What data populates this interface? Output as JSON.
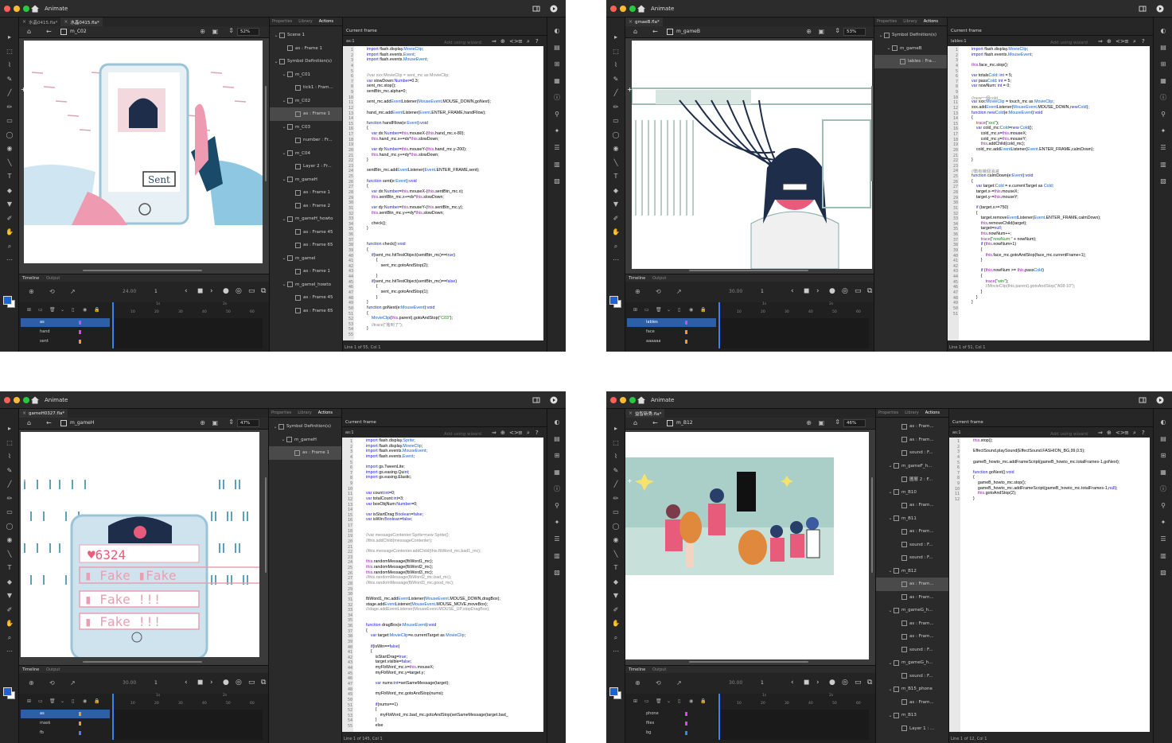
{
  "theme": {
    "accent": "#2d5fa6",
    "layer_pink": "#d946ef",
    "layer_orange": "#f59e0b"
  },
  "app_title": "Animate",
  "windows": [
    {
      "id": "w1",
      "tabs": [
        "水晶0415.fla*",
        "水晶0415.fla*"
      ],
      "symbol": "m_C02",
      "zoom": "52%",
      "fps": "24.00",
      "frame": "1",
      "props_tabs": [
        "Properties",
        "Library",
        "Actions"
      ],
      "tree": [
        {
          "label": "Scene 1",
          "level": 0,
          "chev": "v"
        },
        {
          "label": "as : Frame 1",
          "level": 1,
          "chev": ""
        },
        {
          "label": "Symbol Definition(s)",
          "level": 0,
          "chev": "v"
        },
        {
          "label": "m_C01",
          "level": 1,
          "chev": "v"
        },
        {
          "label": "tick1 : Fram...",
          "level": 2,
          "chev": ""
        },
        {
          "label": "m_C02",
          "level": 1,
          "chev": "v"
        },
        {
          "label": "as : Frame 1",
          "level": 2,
          "chev": "",
          "sel": true
        },
        {
          "label": "m_C03",
          "level": 1,
          "chev": "v"
        },
        {
          "label": "number : Fr...",
          "level": 2,
          "chev": ""
        },
        {
          "label": "m_C04",
          "level": 1,
          "chev": "v"
        },
        {
          "label": "Layer 2 : Fr...",
          "level": 2,
          "chev": ""
        },
        {
          "label": "m_gameH",
          "level": 1,
          "chev": "v"
        },
        {
          "label": "as : Frame 1",
          "level": 2,
          "chev": ""
        },
        {
          "label": "as : Frame 2",
          "level": 2,
          "chev": ""
        },
        {
          "label": "m_gameH_howto",
          "level": 1,
          "chev": "v"
        },
        {
          "label": "as : Frame 45",
          "level": 2,
          "chev": ""
        },
        {
          "label": "as : Frame 65",
          "level": 2,
          "chev": ""
        },
        {
          "label": "m_gameI",
          "level": 1,
          "chev": "v"
        },
        {
          "label": "as : Frame 1",
          "level": 2,
          "chev": ""
        },
        {
          "label": "m_gameI_howto",
          "level": 1,
          "chev": "v"
        },
        {
          "label": "as : Frame 45",
          "level": 2,
          "chev": ""
        },
        {
          "label": "as : Frame 65",
          "level": 2,
          "chev": ""
        }
      ],
      "actions_header": "Current frame",
      "actions_frame": "as:1",
      "wizard": "Add using wizard",
      "code": [
        "import flash.display.MovieClip;",
        "import flash.events.Event;",
        "import flash.events.MouseEvent;",
        "",
        "",
        "//var xxx:MovieClip = sent_mc as MovieClip;",
        "var slowDown:Number=0.3;",
        "sent_mc.stop();",
        "sentBtn_mc.alpha=0;",
        "",
        "sent_mc.addEventListener(MouseEvent.MOUSE_DOWN,goNext);",
        "",
        "hand_mc.addEventListener(Event.ENTER_FRAME,handFllow);",
        "",
        "function handFllow(e:Event):void",
        "{",
        "    var dx:Number=this.mouseX-(this.hand_mc.x-80);",
        "    this.hand_mc.x+=dx*this.slowDown;",
        "",
        "    var dy:Number=this.mouseY-(this.hand_mc.y-200);",
        "    this.hand_mc.y+=dy*this.slowDown;",
        "}",
        "",
        "sentBtn_mc.addEventListener(Event.ENTER_FRAME,sent);",
        "",
        "function sent(e:Event):void",
        "{",
        "    var dx:Number=this.mouseX-(this.sentBtn_mc.x);",
        "    this.sentBtn_mc.x+=dx*this.slowDown;",
        "",
        "    var dy:Number=this.mouseY-(this.sentBtn_mc.y);",
        "    this.sentBtn_mc.y+=dy*this.slowDown;",
        "",
        "    check();",
        "}",
        "",
        "",
        "function check():void",
        "{",
        "    if(sent_mc.hitTestObject(sentBtn_mc)==true)",
        "        {",
        "            sent_mc.gotoAndStop(2);",
        "",
        "        }",
        "    if(sent_mc.hitTestObject(sentBtn_mc)==false)",
        "        {",
        "            sent_mc.gotoAndStop(1);",
        "        }",
        "}",
        "function goNext(e:MouseEvent):void",
        "{",
        "    MovieClip(this.parent).gotoAndStop(\"C03\");",
        "    //trace(\"搖到了\");",
        "}",
        ""
      ],
      "status": "Line 1 of 55, Col 1",
      "layers": [
        {
          "name": "as",
          "color": "#d946ef",
          "sel": true
        },
        {
          "name": "hand",
          "color": "#d946ef"
        },
        {
          "name": "sent",
          "color": "#f59e0b"
        }
      ],
      "ruler": [
        "1s",
        "2s",
        "10",
        "20",
        "30",
        "40",
        "50",
        "60"
      ]
    },
    {
      "id": "w2",
      "tabs": [
        "gmaeB.fla*"
      ],
      "symbol": "m_gameB",
      "zoom": "53%",
      "fps": "30.00",
      "frame": "1",
      "props_tabs": [
        "Properties",
        "Library",
        "Actions"
      ],
      "tree": [
        {
          "label": "Symbol Definition(s)",
          "level": 0,
          "chev": "v"
        },
        {
          "label": "m_gameB",
          "level": 1,
          "chev": "v"
        },
        {
          "label": "lables : Fra...",
          "level": 2,
          "chev": "",
          "sel": true
        }
      ],
      "actions_header": "Current frame",
      "actions_frame": "lables:1",
      "wizard": "Add using wizard",
      "code": [
        "import flash.display.MovieClip;",
        "import flash.events.MouseEvent;",
        "",
        "this.face_mc.stop();",
        "",
        "var totalsCold: int = 5;",
        "var passCold: int = 5;",
        "var nowNum: int = 0;",
        "",
        "//new一個cold",
        "var xxx:MovieClip = touch_mc as MovieClip;",
        "xxx.addEventListener(MouseEvent.MOUSE_DOWN,newCold);",
        "function newCold(e:MouseEvent):void",
        "{",
        "    trace(\"xxx\");",
        "    var cold_mc:Cold=new Cold();",
        "        cold_mc.x=this.mouseX;",
        "        cold_mc.y=this.mouseY;",
        "        this.addChild(cold_mc);",
        "    cold_mc.addEventListener(Event.ENTER_FRAME,calmDown);",
        "",
        "}",
        "",
        "//數有幾個消滅",
        "function calmDown(e:Event):void",
        "{",
        "    var target:Cold = e.currentTarget as Cold;",
        "    target.x-=this.mouseX;",
        "    target.y-=this.mouseY;",
        "",
        "    if (target.x>=750)",
        "    {",
        "        target.removeEventListener(Event.ENTER_FRAME,calmDown);",
        "        this.removeChild(target);",
        "        target=null;",
        "        this.nowNum++;",
        "        trace(\"nowNum:\" + nowNum);",
        "        if (this.nowNum+1)",
        "        {",
        "            this.face_mc.gotoAndStop(face_mc.currentFrame+1);",
        "        }",
        "",
        "        if (this.nowNum >= this.passCold)",
        "        {",
        "            trace(\"win\");",
        "            //MovieClip(this.parent).gotoAndStop(\"A08-10\");",
        "        }",
        "    }",
        "}",
        "",
        ""
      ],
      "status": "Line 1 of 51, Col 1",
      "layers": [
        {
          "name": "lables",
          "color": "#d946ef",
          "sel": true
        },
        {
          "name": "face",
          "color": "#f59e0b"
        },
        {
          "name": "aaaaaa",
          "color": "#f59e0b"
        }
      ],
      "ruler": [
        "1s",
        "2s",
        "10",
        "20",
        "30",
        "40",
        "50",
        "60"
      ]
    },
    {
      "id": "w3",
      "tabs": [
        "gameH0327.fla*"
      ],
      "symbol": "m_gameH",
      "zoom": "47%",
      "fps": "30.00",
      "frame": "1",
      "props_tabs": [
        "Properties",
        "Library",
        "Actions"
      ],
      "tree": [
        {
          "label": "Symbol Definition(s)",
          "level": 0,
          "chev": "v"
        },
        {
          "label": "m_gameH",
          "level": 1,
          "chev": "v"
        },
        {
          "label": "as : Frame 1",
          "level": 2,
          "chev": "",
          "sel": true
        }
      ],
      "actions_header": "Current frame",
      "actions_frame": "as:1",
      "wizard": "Add using wizard",
      "code": [
        "import flash.display.Sprite;",
        "import flash.display.MovieClip;",
        "import flash.events.MouseEvent;",
        "import flash.events.Event;",
        "",
        "import gs.TweenLite;",
        "import gs.easing.Quint;",
        "import gs.easing.Elastic;",
        "",
        "",
        "var count:int=0;",
        "var totalCount:int=3;",
        "var boxObjNum:Number=0;",
        "",
        "var isStartDrag:Boolean=false;",
        "var isWin:Boolean=false;",
        "",
        "",
        "//var messageContenter:Sprite=new Sprite();",
        "//this.addChild(messageContenter);",
        "",
        "//this.messageContenter.addChild(this.fbWord_mc.bad1_mc);",
        "",
        "this.randomMessage(fbWord1_mc);",
        "this.randomMessage(fbWord2_mc);",
        "this.randomMessage(fbWord3_mc);",
        "//this.randomMessage(fbWord2_mc.bad_mc);",
        "//this.randomMessage(fbWord3_mc.good_mc);",
        "",
        "",
        "fbWord1_mc.addEventListener(MouseEvent.MOUSE_DOWN,dragBox);",
        "stage.addEventListener(MouseEvent.MOUSE_MOVE,moveBox);",
        "//stage.addEventListener(MouseEvent.MOUSE_UP,stopDragBox);",
        "",
        "",
        "function dragBox(e:MouseEvent):void",
        "{",
        "    var target:MovieClip=e.currentTarget as MovieClip;",
        "",
        "    if(isWin==false)",
        "    {",
        "        isStartDrag=true;",
        "        target.visible=false;",
        "        myFbWord_mc.x=this.mouseX;",
        "        myFbWord_mc.y=target.y;",
        "",
        "        var nums:int=setSameMessage(target);",
        "",
        "        myFbWord_mc.gotoAndStop(nums);",
        "",
        "        if(nums==1)",
        "        {",
        "            myFbWord_mc.bad_mc.gotoAndStop(setSameMessage(target.bad_",
        "        }",
        "        else"
      ],
      "status": "Line 1 of 145, Col 1",
      "layers": [
        {
          "name": "as",
          "color": "#f59e0b",
          "sel": true
        },
        {
          "name": "mask",
          "color": "#f59e0b"
        },
        {
          "name": "fb",
          "color": "#3b82f6"
        }
      ],
      "ruler": [
        "1s",
        "2s",
        "10",
        "20",
        "30",
        "40",
        "50",
        "60"
      ]
    },
    {
      "id": "w4",
      "tabs": [
        "益智新秀.fla*"
      ],
      "symbol": "m_B12",
      "zoom": "46%",
      "fps": "30.00",
      "frame": "1",
      "props_tabs": [
        "Properties",
        "Library",
        "Actions"
      ],
      "tree": [
        {
          "label": "as : Fram...",
          "level": 2,
          "chev": ""
        },
        {
          "label": "as : Fram...",
          "level": 2,
          "chev": ""
        },
        {
          "label": "sound : F...",
          "level": 2,
          "chev": ""
        },
        {
          "label": "m_gameF_h...",
          "level": 1,
          "chev": "v"
        },
        {
          "label": "圖層 2 : F...",
          "level": 2,
          "chev": ""
        },
        {
          "label": "m_B10",
          "level": 1,
          "chev": "v"
        },
        {
          "label": "as : Fram...",
          "level": 2,
          "chev": ""
        },
        {
          "label": "m_B11",
          "level": 1,
          "chev": "v"
        },
        {
          "label": "as : Fram...",
          "level": 2,
          "chev": ""
        },
        {
          "label": "sound : F...",
          "level": 2,
          "chev": ""
        },
        {
          "label": "sound : F...",
          "level": 2,
          "chev": ""
        },
        {
          "label": "m_B12",
          "level": 1,
          "chev": "v"
        },
        {
          "label": "as : Fram...",
          "level": 2,
          "chev": "",
          "sel": true
        },
        {
          "label": "as : Fram...",
          "level": 2,
          "chev": ""
        },
        {
          "label": "m_gameG_h...",
          "level": 1,
          "chev": "v"
        },
        {
          "label": "as : Fram...",
          "level": 2,
          "chev": ""
        },
        {
          "label": "as : Fram...",
          "level": 2,
          "chev": ""
        },
        {
          "label": "sound : F...",
          "level": 2,
          "chev": ""
        },
        {
          "label": "m_gameG_h...",
          "level": 1,
          "chev": "v"
        },
        {
          "label": "sound : F...",
          "level": 2,
          "chev": ""
        },
        {
          "label": "m_B15_phone",
          "level": 1,
          "chev": "v"
        },
        {
          "label": "as : Fram...",
          "level": 2,
          "chev": ""
        },
        {
          "label": "m_B13",
          "level": 1,
          "chev": "v"
        },
        {
          "label": "Layer 1 : ...",
          "level": 2,
          "chev": ""
        }
      ],
      "actions_header": "Current frame",
      "actions_frame": "as:1",
      "wizard": "Add using wizard",
      "code": [
        "this.stop();",
        "",
        "EffectSound.playSound(EffectSound.FASHION_BG,99,0.5);",
        "",
        "gameB_howto_mc.addFrameScript(gameB_howto_mc.totalFrames-1,goNext);",
        "",
        "function goNext():void",
        "{",
        "    gameB_howto_mc.stop();",
        "    gameB_howto_mc.addFrameScript(gameB_howto_mc.totalFrames-1,null);",
        "    this.gotoAndStop(2);",
        "}"
      ],
      "status": "Line 1 of 12, Col 1",
      "layers": [
        {
          "name": "phone",
          "color": "#d946ef"
        },
        {
          "name": "files",
          "color": "#d946ef"
        },
        {
          "name": "bg",
          "color": "#3b82f6"
        }
      ],
      "ruler": [
        "1s",
        "2s",
        "10",
        "20",
        "30",
        "40",
        "50",
        "60"
      ]
    }
  ]
}
